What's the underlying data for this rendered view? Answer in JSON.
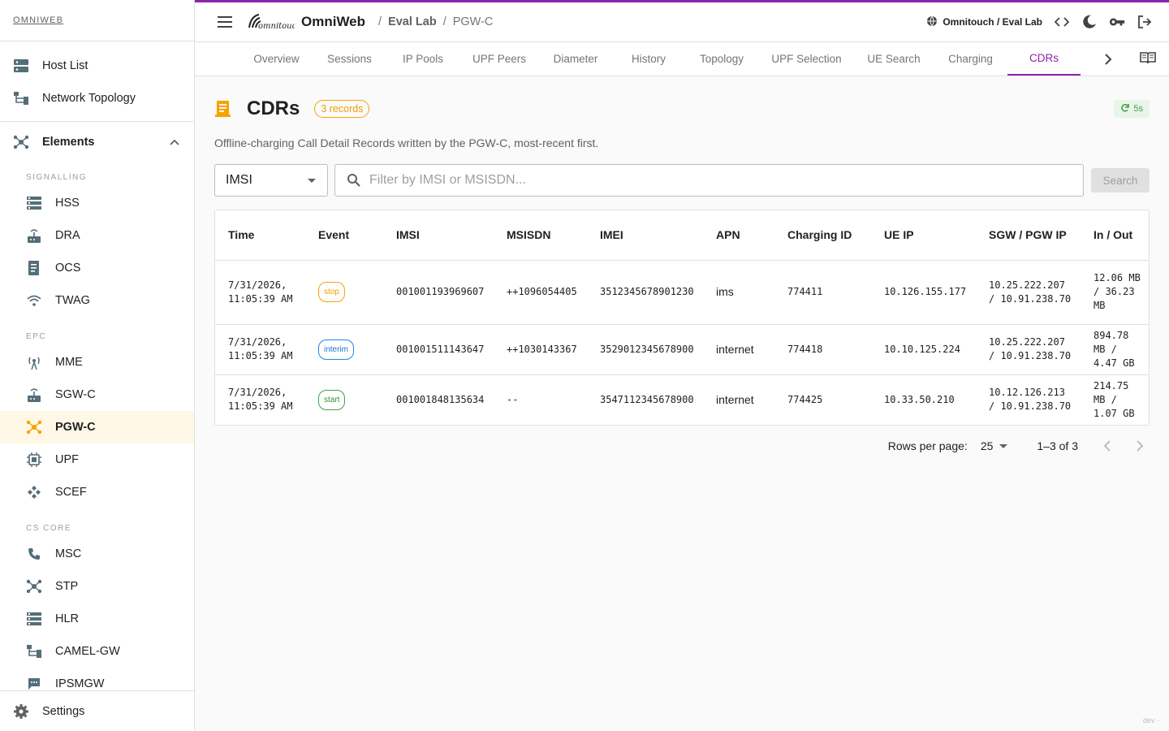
{
  "brand": "OMNIWEB",
  "sidebar": {
    "top_items": [
      {
        "label": "Host List",
        "icon": "server-list-icon"
      },
      {
        "label": "Network Topology",
        "icon": "topology-icon"
      }
    ],
    "elements_label": "Elements",
    "sections": [
      {
        "title": "SIGNALLING",
        "items": [
          "HSS",
          "DRA",
          "OCS",
          "TWAG"
        ]
      },
      {
        "title": "EPC",
        "items": [
          "MME",
          "SGW-C",
          "PGW-C",
          "UPF",
          "SCEF"
        ]
      },
      {
        "title": "CS CORE",
        "items": [
          "MSC",
          "STP",
          "HLR",
          "CAMEL-GW",
          "IPSMGW"
        ]
      }
    ],
    "active_item": "PGW-C",
    "settings_label": "Settings"
  },
  "topbar": {
    "app_title": "OmniWeb",
    "logo_text": "omnitouch",
    "breadcrumb": [
      "Eval Lab",
      "PGW-C"
    ],
    "environment": "Omnitouch / Eval Lab"
  },
  "tabs": [
    "Overview",
    "Sessions",
    "IP Pools",
    "UPF Peers",
    "Diameter",
    "History",
    "Topology",
    "UPF Selection",
    "UE Search",
    "Charging",
    "CDRs"
  ],
  "active_tab": "CDRs",
  "page": {
    "title": "CDRs",
    "records_badge": "3 records",
    "refresh_label": "5s",
    "description": "Offline-charging Call Detail Records written by the PGW-C, most-recent first."
  },
  "filter": {
    "field_value": "IMSI",
    "search_placeholder": "Filter by IMSI or MSISDN...",
    "search_button": "Search"
  },
  "table": {
    "headers": [
      "Time",
      "Event",
      "IMSI",
      "MSISDN",
      "IMEI",
      "APN",
      "Charging ID",
      "UE IP",
      "SGW / PGW IP",
      "In / Out"
    ],
    "rows": [
      {
        "time": "7/31/2026, 11:05:39 AM",
        "event": "stop",
        "imsi": "001001193969607",
        "msisdn": "++1096054405",
        "imei": "3512345678901230",
        "apn": "ims",
        "charging_id": "774411",
        "ue_ip": "10.126.155.177",
        "sgw_pgw": "10.25.222.207 / 10.91.238.70",
        "in_out": "12.06 MB / 36.23 MB"
      },
      {
        "time": "7/31/2026, 11:05:39 AM",
        "event": "interim",
        "imsi": "001001511143647",
        "msisdn": "++1030143367",
        "imei": "3529012345678900",
        "apn": "internet",
        "charging_id": "774418",
        "ue_ip": "10.10.125.224",
        "sgw_pgw": "10.25.222.207 / 10.91.238.70",
        "in_out": "894.78 MB / 4.47 GB"
      },
      {
        "time": "7/31/2026, 11:05:39 AM",
        "event": "start",
        "imsi": "001001848135634",
        "msisdn": "--",
        "imei": "3547112345678900",
        "apn": "internet",
        "charging_id": "774425",
        "ue_ip": "10.33.50.210",
        "sgw_pgw": "10.12.126.213 / 10.91.238.70",
        "in_out": "214.75 MB / 1.07 GB"
      }
    ]
  },
  "pagination": {
    "rows_per_page_label": "Rows per page:",
    "rows_per_page": "25",
    "range": "1–3 of 3"
  },
  "footer_tag": "dev ·",
  "colors": {
    "accent": "#8e24aa",
    "brand_orange": "#f5a400",
    "stop": "#f5a400",
    "interim": "#1e88e5",
    "start": "#43a047"
  }
}
